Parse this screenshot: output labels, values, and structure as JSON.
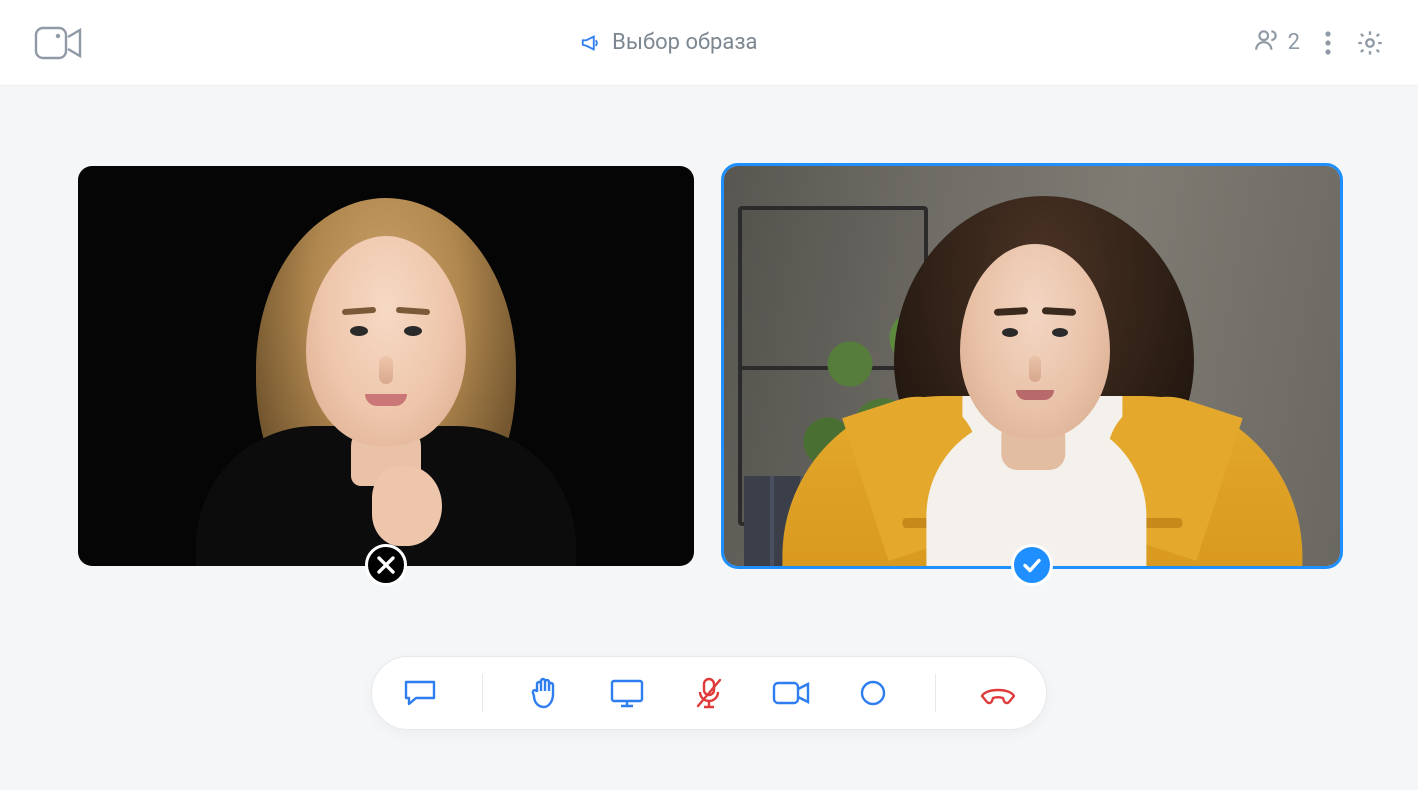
{
  "header": {
    "title": "Выбор образа",
    "participant_count": "2"
  },
  "colors": {
    "accent": "#1f8fff",
    "danger": "#e03b3b",
    "icon_muted": "#8f9aa6",
    "icon_blue": "#2e7ef0"
  },
  "participants": [
    {
      "id": "p1",
      "selected": false,
      "badge": "reject"
    },
    {
      "id": "p2",
      "selected": true,
      "badge": "accept"
    }
  ],
  "toolbar": {
    "buttons": [
      {
        "name": "chat",
        "icon": "chat-icon",
        "color": "#2e7ef0"
      },
      {
        "name": "raise-hand",
        "icon": "hand-icon",
        "color": "#2e7ef0"
      },
      {
        "name": "share",
        "icon": "screen-icon",
        "color": "#2e7ef0"
      },
      {
        "name": "mic-muted",
        "icon": "mic-off-icon",
        "color": "#e03b3b"
      },
      {
        "name": "camera",
        "icon": "camera-icon",
        "color": "#2e7ef0"
      },
      {
        "name": "record",
        "icon": "record-icon",
        "color": "#2e7ef0"
      },
      {
        "name": "end-call",
        "icon": "hangup-icon",
        "color": "#e03b3b"
      }
    ],
    "separators_after": [
      0,
      5
    ]
  }
}
